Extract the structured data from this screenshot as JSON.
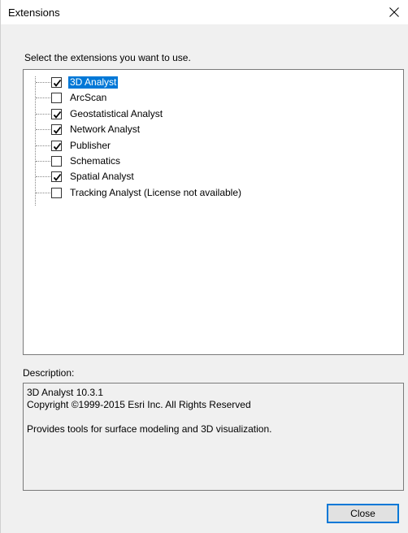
{
  "window": {
    "title": "Extensions",
    "close_icon": "close-x-icon"
  },
  "instruction": "Select the extensions you want to use.",
  "extensions": [
    {
      "label": "3D Analyst",
      "checked": true,
      "selected": true
    },
    {
      "label": "ArcScan",
      "checked": false,
      "selected": false
    },
    {
      "label": "Geostatistical Analyst",
      "checked": true,
      "selected": false
    },
    {
      "label": "Network Analyst",
      "checked": true,
      "selected": false
    },
    {
      "label": "Publisher",
      "checked": true,
      "selected": false
    },
    {
      "label": "Schematics",
      "checked": false,
      "selected": false
    },
    {
      "label": "Spatial Analyst",
      "checked": true,
      "selected": false
    },
    {
      "label": "Tracking Analyst (License not available)",
      "checked": false,
      "selected": false
    }
  ],
  "description": {
    "label": "Description:",
    "line1": "3D Analyst 10.3.1",
    "line2": "Copyright ©1999-2015 Esri Inc. All Rights Reserved",
    "line3": "Provides tools for surface modeling and 3D visualization."
  },
  "buttons": {
    "close_label": "Close"
  },
  "colors": {
    "selection": "#0078d7",
    "button_border": "#0078d7"
  }
}
